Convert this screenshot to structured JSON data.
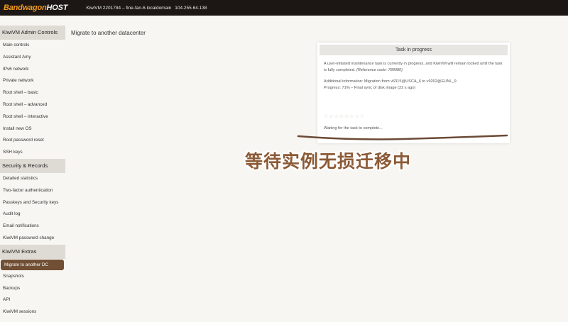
{
  "header": {
    "logo_main": "Bandwagon",
    "logo_sub": "HOST",
    "server_info": "KiwiVM 2201784 – fine-fan-6.localdomain",
    "ip": "104.255.64.138"
  },
  "sidebar": {
    "sections": [
      {
        "title": "KiwiVM Admin Controls",
        "items": [
          "Main controls",
          "Assistant Amy",
          "IPv6 network",
          "Private network",
          "Root shell – basic",
          "Root shell – advanced",
          "Root shell – interactive",
          "Install new OS",
          "Root password reset",
          "SSH keys"
        ]
      },
      {
        "title": "Security & Records",
        "items": [
          "Detailed statistics",
          "Two-factor authentication",
          "Passkeys and Security keys",
          "Audit log",
          "Email notifications",
          "KiwiVM password change"
        ]
      },
      {
        "title": "KiwiVM Extras",
        "items": [
          "Migrate to another DC",
          "Snapshots",
          "Backups",
          "API",
          "KiwiVM sessions"
        ]
      }
    ],
    "active_item": "Migrate to another DC"
  },
  "main": {
    "page_title": "Migrate to another datacenter",
    "task_card": {
      "title": "Task in progress",
      "message": "A user-initiated maintenance task is currently in progress, and KiwiVM will remain locked until the task is fully completed.",
      "reference": "(Reference code: 788980)",
      "additional_info": "Additional information: Migration from v6315@USCA_6 to v9202@EUNL_9",
      "progress": "Progress: 71% – Final sync of disk image (22 s ago)",
      "stars": "☆☆☆☆☆☆☆☆",
      "waiting": "Waiting for the task to complete..."
    }
  },
  "overlay": {
    "caption": "等待实例无损迁移中"
  },
  "colors": {
    "topbar": "#1c1714",
    "logo": "#f39a1e",
    "active_item": "#704f34",
    "section_bg": "#dedad4",
    "overlay_text": "#8b5a36",
    "underline": "#6b4a35"
  }
}
